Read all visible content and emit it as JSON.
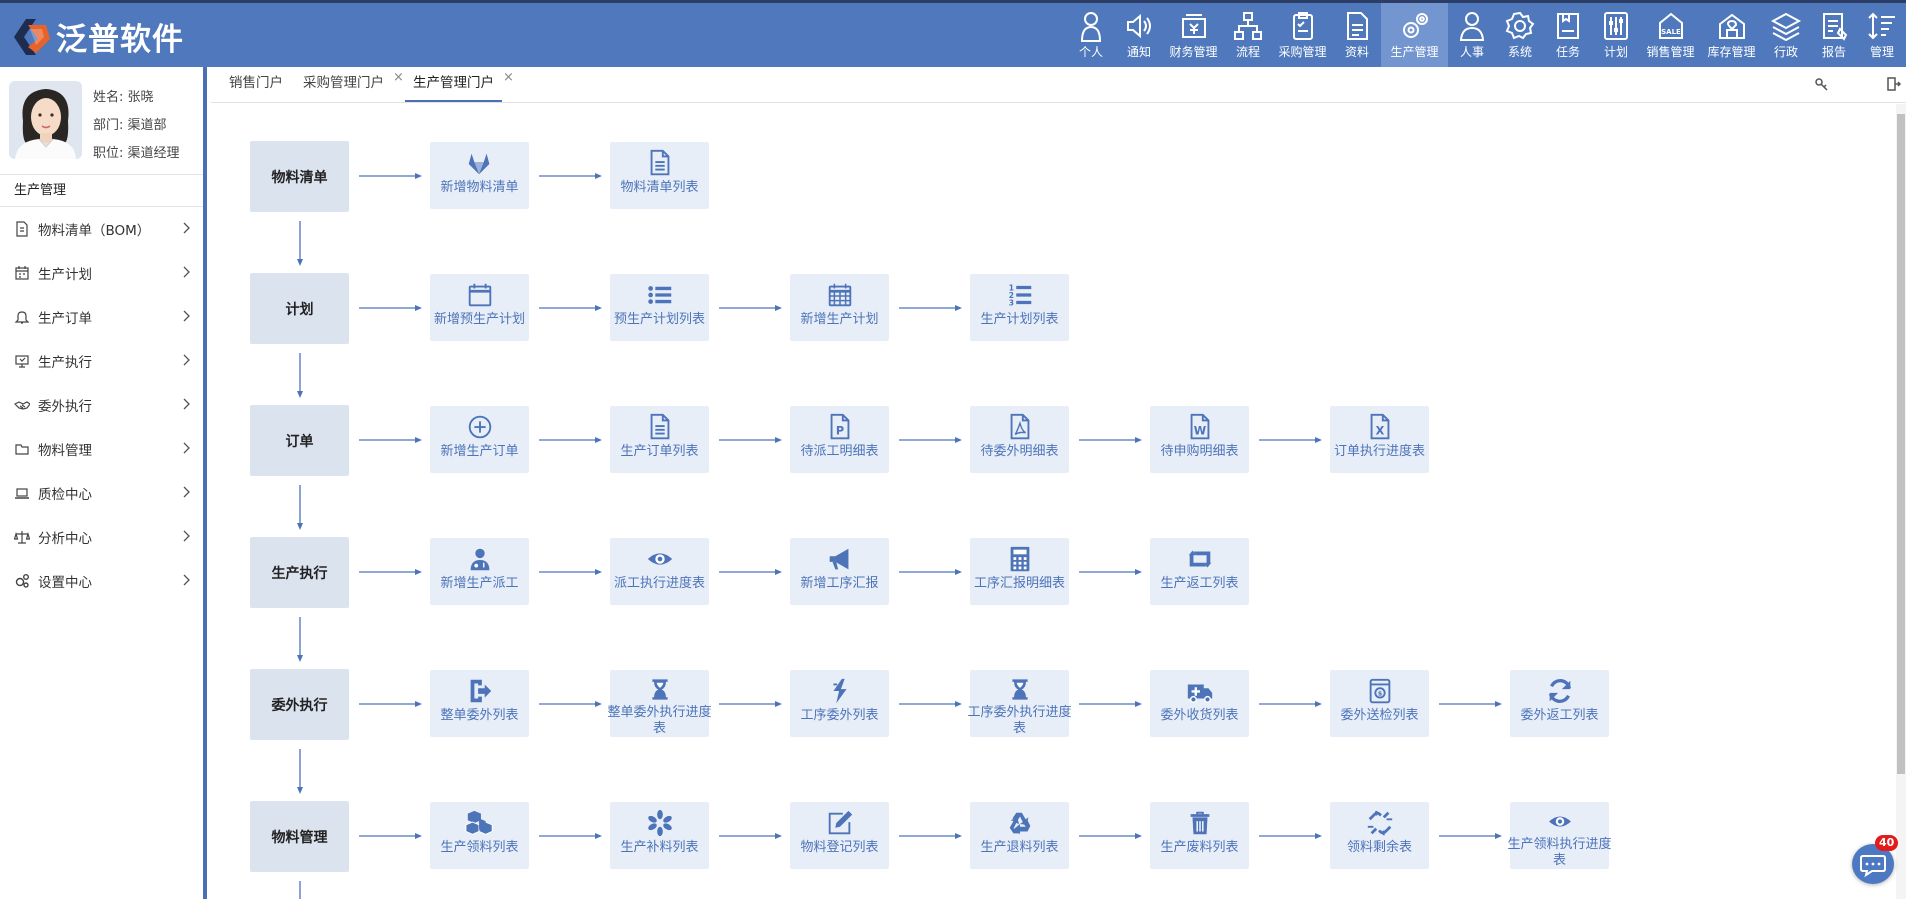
{
  "app": {
    "title": "泛普软件"
  },
  "colors": {
    "topbar": "#5079bd",
    "active_nav": "#7396d0",
    "node_bg": "#e8eef8",
    "category_bg": "#dbe3ef",
    "accent": "#4d74b8"
  },
  "nav": [
    {
      "label": "个人",
      "icon": "person-icon"
    },
    {
      "label": "通知",
      "icon": "speaker-icon"
    },
    {
      "label": "财务管理",
      "icon": "finance-icon"
    },
    {
      "label": "流程",
      "icon": "flow-icon"
    },
    {
      "label": "采购管理",
      "icon": "clipboard-icon"
    },
    {
      "label": "资料",
      "icon": "document-icon"
    },
    {
      "label": "生产管理",
      "icon": "gears-icon",
      "active": true
    },
    {
      "label": "人事",
      "icon": "user-icon"
    },
    {
      "label": "系统",
      "icon": "gear-icon"
    },
    {
      "label": "任务",
      "icon": "task-icon"
    },
    {
      "label": "计划",
      "icon": "sliders-icon"
    },
    {
      "label": "销售管理",
      "icon": "sale-icon"
    },
    {
      "label": "库存管理",
      "icon": "warehouse-icon"
    },
    {
      "label": "行政",
      "icon": "layers-icon"
    },
    {
      "label": "报告",
      "icon": "report-icon"
    },
    {
      "label": "管理",
      "icon": "sort-icon"
    }
  ],
  "profile": {
    "name": "姓名: 张晓",
    "dept": "部门: 渠道部",
    "position": "职位: 渠道经理"
  },
  "sidebar": {
    "title": "生产管理",
    "items": [
      {
        "label": "物料清单（BOM）",
        "icon": "file-icon"
      },
      {
        "label": "生产计划",
        "icon": "calendar-icon"
      },
      {
        "label": "生产订单",
        "icon": "bell-icon"
      },
      {
        "label": "生产执行",
        "icon": "monitor-icon"
      },
      {
        "label": "委外执行",
        "icon": "handshake-icon"
      },
      {
        "label": "物料管理",
        "icon": "folder-icon"
      },
      {
        "label": "质检中心",
        "icon": "laptop-icon"
      },
      {
        "label": "分析中心",
        "icon": "scale-icon"
      },
      {
        "label": "设置中心",
        "icon": "cogs-icon"
      }
    ]
  },
  "tabs": [
    {
      "label": "销售门户",
      "closable": false
    },
    {
      "label": "采购管理门户",
      "closable": true
    },
    {
      "label": "生产管理门户",
      "closable": true,
      "active": true
    }
  ],
  "close_glyph": "×",
  "flow": [
    {
      "category": "物料清单",
      "nodes": [
        {
          "label": "新增物料清单",
          "icon": "gitlab-icon"
        },
        {
          "label": "物料清单列表",
          "icon": "file-text-icon"
        }
      ]
    },
    {
      "category": "计划",
      "nodes": [
        {
          "label": "新增预生产计划",
          "icon": "calendar-blank-icon"
        },
        {
          "label": "预生产计划列表",
          "icon": "list-icon"
        },
        {
          "label": "新增生产计划",
          "icon": "calendar-grid-icon"
        },
        {
          "label": "生产计划列表",
          "icon": "ordered-list-icon"
        }
      ]
    },
    {
      "category": "订单",
      "nodes": [
        {
          "label": "新增生产订单",
          "icon": "plus-circle-icon"
        },
        {
          "label": "生产订单列表",
          "icon": "file-text-icon"
        },
        {
          "label": "待派工明细表",
          "icon": "file-p-icon"
        },
        {
          "label": "待委外明细表",
          "icon": "file-pdf-icon"
        },
        {
          "label": "待申购明细表",
          "icon": "file-word-icon"
        },
        {
          "label": "订单执行进度表",
          "icon": "file-excel-icon"
        }
      ]
    },
    {
      "category": "生产执行",
      "nodes": [
        {
          "label": "新增生产派工",
          "icon": "user-md-icon"
        },
        {
          "label": "派工执行进度表",
          "icon": "eye-icon"
        },
        {
          "label": "新增工序汇报",
          "icon": "bullhorn-icon"
        },
        {
          "label": "工序汇报明细表",
          "icon": "calculator-icon"
        },
        {
          "label": "生产返工列表",
          "icon": "retweet-icon"
        }
      ]
    },
    {
      "category": "委外执行",
      "nodes": [
        {
          "label": "整单委外列表",
          "icon": "sign-out-icon"
        },
        {
          "label": "整单委外执行进度表",
          "icon": "hourglass-icon"
        },
        {
          "label": "工序委外列表",
          "icon": "bolt-icon"
        },
        {
          "label": "工序委外执行进度表",
          "icon": "hourglass-icon"
        },
        {
          "label": "委外收货列表",
          "icon": "ambulance-icon"
        },
        {
          "label": "委外送检列表",
          "icon": "badge-icon"
        },
        {
          "label": "委外返工列表",
          "icon": "refresh-icon"
        }
      ]
    },
    {
      "category": "物料管理",
      "nodes": [
        {
          "label": "生产领料列表",
          "icon": "cubes-icon"
        },
        {
          "label": "生产补料列表",
          "icon": "asterisk-icon"
        },
        {
          "label": "物料登记列表",
          "icon": "edit-icon"
        },
        {
          "label": "生产退料列表",
          "icon": "recycle-icon"
        },
        {
          "label": "生产废料列表",
          "icon": "trash-icon"
        },
        {
          "label": "领料剩余表",
          "icon": "chain-broken-icon"
        },
        {
          "label": "生产领料执行进度表",
          "icon": "eye-icon"
        }
      ]
    }
  ],
  "chat": {
    "badge": "40"
  }
}
